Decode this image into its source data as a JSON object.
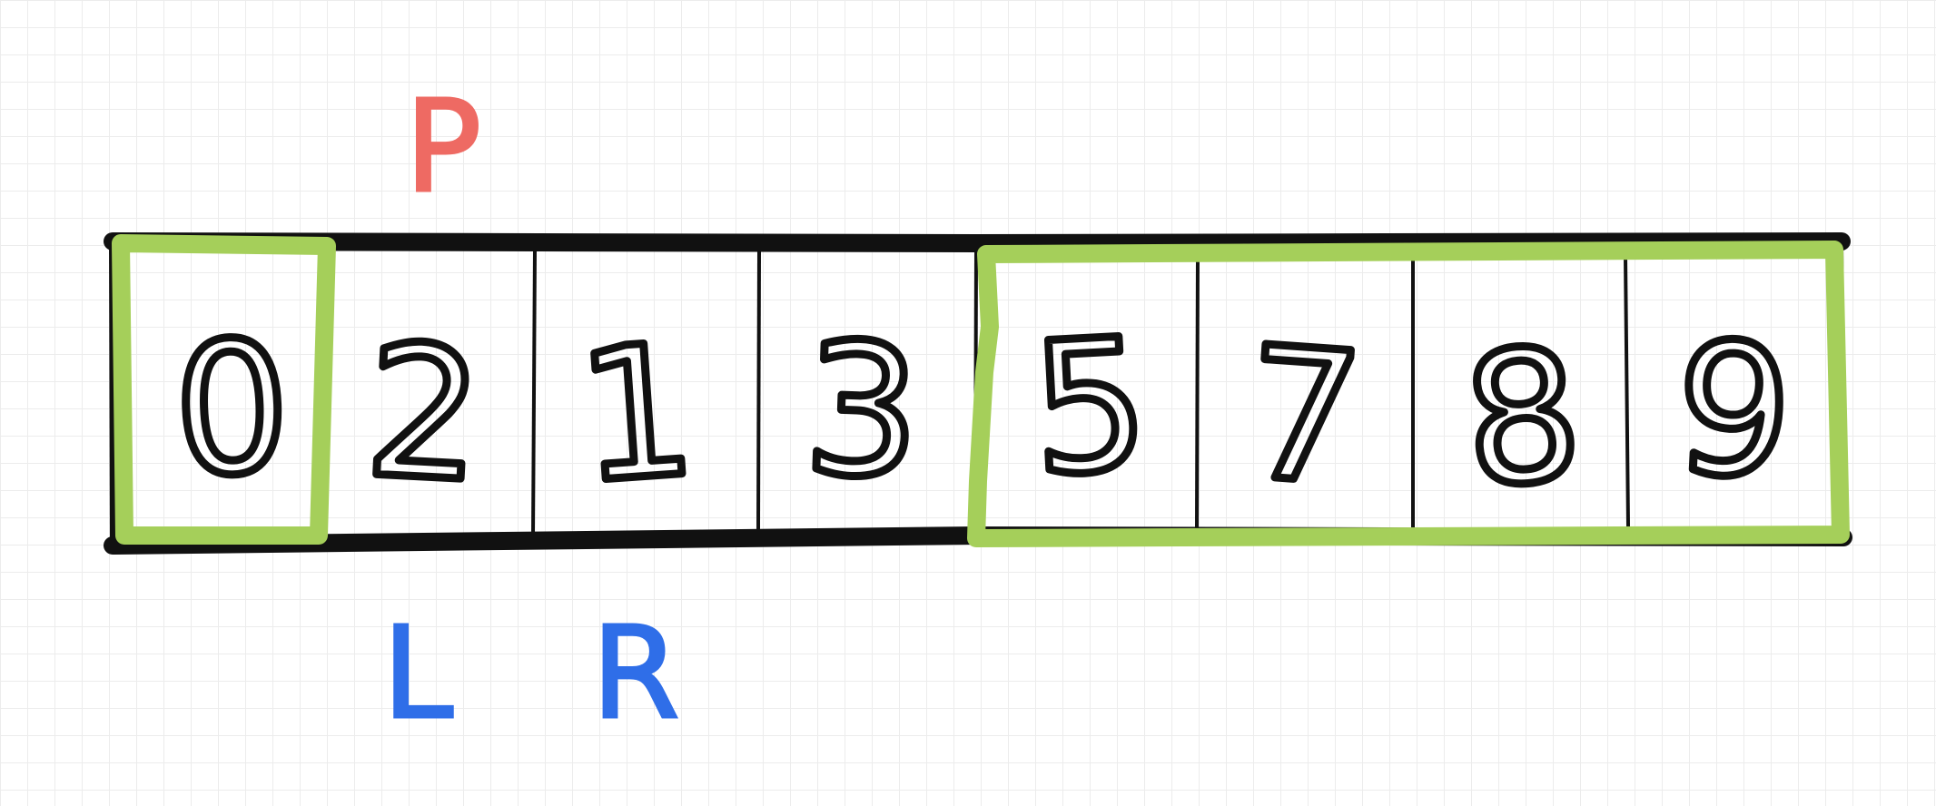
{
  "array": {
    "cells": [
      "0",
      "2",
      "1",
      "3",
      "5",
      "7",
      "8",
      "9"
    ]
  },
  "pointers": {
    "p": {
      "label": "P",
      "color": "#ee6a63",
      "index": 1
    },
    "l": {
      "label": "L",
      "color": "#2f6ee8",
      "index": 1
    },
    "r": {
      "label": "R",
      "color": "#2f6ee8",
      "index": 2
    }
  },
  "highlights": {
    "color": "#a5cf5a",
    "groups": [
      {
        "name": "left-group",
        "from_index": 0,
        "to_index": 0
      },
      {
        "name": "right-group",
        "from_index": 4,
        "to_index": 7
      }
    ]
  },
  "colors": {
    "ink": "#111111",
    "grid": "#ececec",
    "background": "#ffffff"
  }
}
